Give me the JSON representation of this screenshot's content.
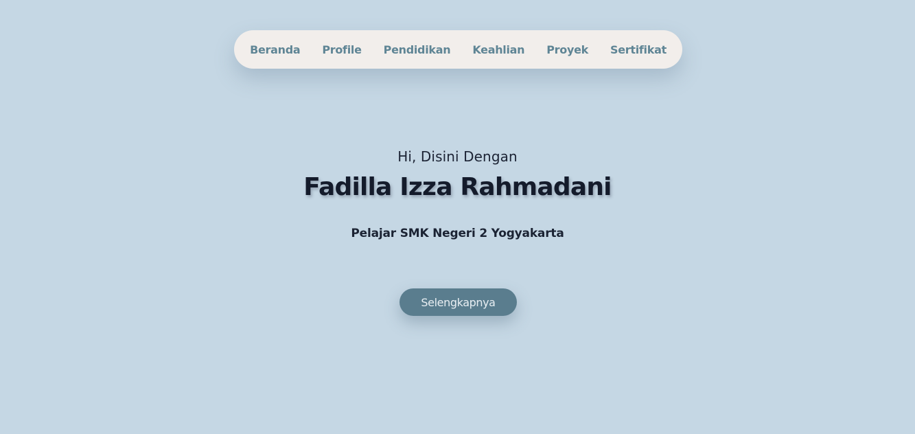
{
  "nav": {
    "items": [
      {
        "label": "Beranda"
      },
      {
        "label": "Profile"
      },
      {
        "label": "Pendidikan"
      },
      {
        "label": "Keahlian"
      },
      {
        "label": "Proyek"
      },
      {
        "label": "Sertifikat"
      }
    ]
  },
  "hero": {
    "greeting": "Hi, Disini Dengan",
    "name": "Fadilla Izza Rahmadani",
    "tagline": "Pelajar SMK Negeri 2 Yogyakarta",
    "cta_label": "Selengkapnya"
  },
  "colors": {
    "background": "#c5d7e4",
    "nav_background": "#f2eeeb",
    "nav_text": "#5f8595",
    "heading_text": "#141b2b",
    "button_background": "#5a7d8e",
    "button_text": "#e9eff3"
  }
}
